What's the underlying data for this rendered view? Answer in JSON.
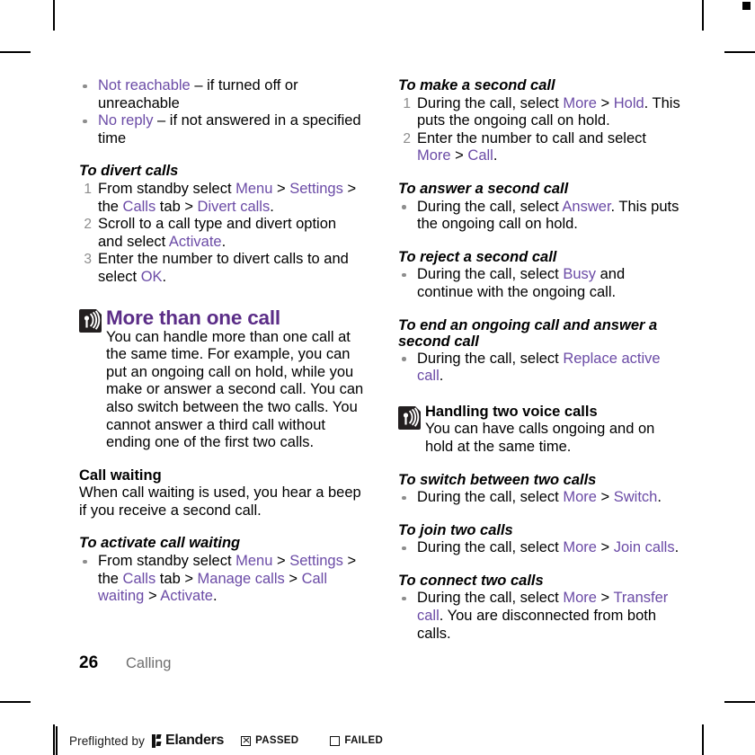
{
  "document": {
    "page_number": "26",
    "running_title": "Calling"
  },
  "left_column": {
    "intro_bullets": [
      {
        "link": "Not reachable",
        "rest": " – if turned off or unreachable"
      },
      {
        "link": "No reply",
        "rest": " – if not answered in a specified time"
      }
    ],
    "divert": {
      "heading": "To divert calls",
      "steps": [
        {
          "number": "1",
          "parts": [
            {
              "t": "From standby select ",
              "k": "plain"
            },
            {
              "t": "Menu",
              "k": "link"
            },
            {
              "t": " > ",
              "k": "plain"
            },
            {
              "t": "Settings",
              "k": "link"
            },
            {
              "t": " > the ",
              "k": "plain"
            },
            {
              "t": "Calls",
              "k": "link"
            },
            {
              "t": " tab > ",
              "k": "plain"
            },
            {
              "t": "Divert calls",
              "k": "link"
            },
            {
              "t": ".",
              "k": "plain"
            }
          ]
        },
        {
          "number": "2",
          "parts": [
            {
              "t": "Scroll to a call type and divert option and select ",
              "k": "plain"
            },
            {
              "t": "Activate",
              "k": "link"
            },
            {
              "t": ".",
              "k": "plain"
            }
          ]
        },
        {
          "number": "3",
          "parts": [
            {
              "t": "Enter the number to divert calls to and select ",
              "k": "plain"
            },
            {
              "t": "OK",
              "k": "link"
            },
            {
              "t": ".",
              "k": "plain"
            }
          ]
        }
      ]
    },
    "more_than_one_call": {
      "icon": "note-broadcast-icon",
      "heading": "More than one call",
      "body": "You can handle more than one call at the same time. For example, you can put an ongoing call on hold, while you make or answer a second call. You can also switch between the two calls. You cannot answer a third call without ending one of the first two calls."
    },
    "call_waiting": {
      "heading": "Call waiting",
      "body": "When call waiting is used, you hear a beep if you receive a second call."
    },
    "activate_call_waiting": {
      "heading": "To activate call waiting",
      "bullets": [
        {
          "parts": [
            {
              "t": "From standby select ",
              "k": "plain"
            },
            {
              "t": "Menu",
              "k": "link"
            },
            {
              "t": " > ",
              "k": "plain"
            },
            {
              "t": "Settings",
              "k": "link"
            },
            {
              "t": " > the ",
              "k": "plain"
            },
            {
              "t": "Calls",
              "k": "link"
            },
            {
              "t": " tab > ",
              "k": "plain"
            },
            {
              "t": "Manage calls",
              "k": "link"
            },
            {
              "t": " > ",
              "k": "plain"
            },
            {
              "t": "Call waiting",
              "k": "link"
            },
            {
              "t": " > ",
              "k": "plain"
            },
            {
              "t": "Activate",
              "k": "link"
            },
            {
              "t": ".",
              "k": "plain"
            }
          ]
        }
      ]
    }
  },
  "right_column": {
    "make_second_call": {
      "heading": "To make a second call",
      "steps": [
        {
          "number": "1",
          "parts": [
            {
              "t": "During the call, select ",
              "k": "plain"
            },
            {
              "t": "More",
              "k": "link"
            },
            {
              "t": " > ",
              "k": "plain"
            },
            {
              "t": "Hold",
              "k": "link"
            },
            {
              "t": ". This puts the ongoing call on hold.",
              "k": "plain"
            }
          ]
        },
        {
          "number": "2",
          "parts": [
            {
              "t": "Enter the number to call and select ",
              "k": "plain"
            },
            {
              "t": "More",
              "k": "link"
            },
            {
              "t": " > ",
              "k": "plain"
            },
            {
              "t": "Call",
              "k": "link"
            },
            {
              "t": ".",
              "k": "plain"
            }
          ]
        }
      ]
    },
    "answer_second_call": {
      "heading": "To answer a second call",
      "bullets": [
        {
          "parts": [
            {
              "t": "During the call, select ",
              "k": "plain"
            },
            {
              "t": "Answer",
              "k": "link"
            },
            {
              "t": ". This puts the ongoing call on hold.",
              "k": "plain"
            }
          ]
        }
      ]
    },
    "reject_second_call": {
      "heading": "To reject a second call",
      "bullets": [
        {
          "parts": [
            {
              "t": "During the call, select ",
              "k": "plain"
            },
            {
              "t": "Busy",
              "k": "link"
            },
            {
              "t": " and continue with the ongoing call.",
              "k": "plain"
            }
          ]
        }
      ]
    },
    "end_and_answer": {
      "heading": "To end an ongoing call and answer a second call",
      "bullets": [
        {
          "parts": [
            {
              "t": "During the call, select ",
              "k": "plain"
            },
            {
              "t": "Replace active call",
              "k": "link"
            },
            {
              "t": ".",
              "k": "plain"
            }
          ]
        }
      ]
    },
    "handling_two_voice_calls": {
      "icon": "note-broadcast-icon",
      "heading": "Handling two voice calls",
      "body": "You can have calls ongoing and on hold at the same time."
    },
    "switch_two_calls": {
      "heading": "To switch between two calls",
      "bullets": [
        {
          "parts": [
            {
              "t": "During the call, select ",
              "k": "plain"
            },
            {
              "t": "More",
              "k": "link"
            },
            {
              "t": " > ",
              "k": "plain"
            },
            {
              "t": "Switch",
              "k": "link"
            },
            {
              "t": ".",
              "k": "plain"
            }
          ]
        }
      ]
    },
    "join_two_calls": {
      "heading": "To join two calls",
      "bullets": [
        {
          "parts": [
            {
              "t": "During the call, select ",
              "k": "plain"
            },
            {
              "t": "More",
              "k": "link"
            },
            {
              "t": " > ",
              "k": "plain"
            },
            {
              "t": "Join calls",
              "k": "link"
            },
            {
              "t": ".",
              "k": "plain"
            }
          ]
        }
      ]
    },
    "connect_two_calls": {
      "heading": "To connect two calls",
      "bullets": [
        {
          "parts": [
            {
              "t": "During the call, select ",
              "k": "plain"
            },
            {
              "t": "More",
              "k": "link"
            },
            {
              "t": " > ",
              "k": "plain"
            },
            {
              "t": "Transfer call",
              "k": "link"
            },
            {
              "t": ". You are disconnected from both calls.",
              "k": "plain"
            }
          ]
        }
      ]
    }
  },
  "preflight": {
    "label": "Preflighted by",
    "brand": "Elanders",
    "passed_label": "PASSED",
    "failed_label": "FAILED",
    "passed_checked": true,
    "failed_checked": false
  },
  "colors": {
    "heading_purple": "#5b2d87",
    "link_purple": "#6b4ba6",
    "list_marker_gray": "#8d8d8d",
    "running_title_gray": "#6e6e6e",
    "icon_dark": "#231f20"
  }
}
